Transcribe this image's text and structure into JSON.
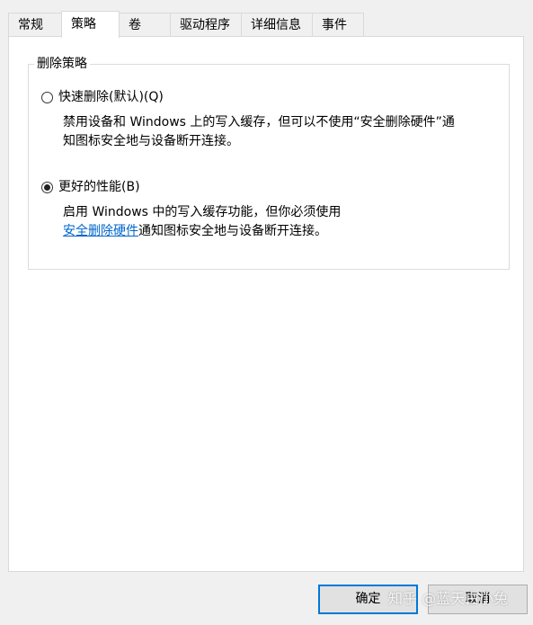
{
  "tabs": [
    {
      "label": "常规"
    },
    {
      "label": "策略",
      "active": true
    },
    {
      "label": "卷"
    },
    {
      "label": "驱动程序"
    },
    {
      "label": "详细信息"
    },
    {
      "label": "事件"
    }
  ],
  "group": {
    "title": "删除策略",
    "option1": {
      "label": "快速删除(默认)(Q)",
      "checked": false,
      "desc_line1": "禁用设备和 Windows 上的写入缓存，但可以不使用“安全删除硬件”通",
      "desc_line2": "知图标安全地与设备断开连接。"
    },
    "option2": {
      "label": "更好的性能(B)",
      "checked": true,
      "desc_line1": "启用 Windows 中的写入缓存功能，但你必须使用",
      "link": "安全删除硬件",
      "desc_line2_rest": "通知图标安全地与设备断开连接。"
    }
  },
  "buttons": {
    "ok": "确定",
    "cancel": "取消"
  },
  "watermark": "知乎 @蓝天白小兔"
}
